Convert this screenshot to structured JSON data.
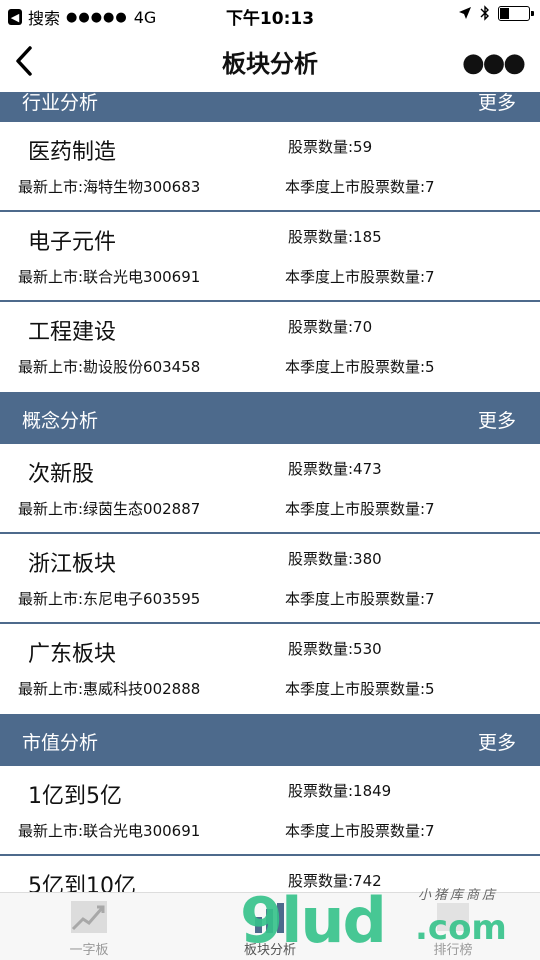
{
  "status_bar": {
    "carrier": "搜索",
    "signal": "●●●●●",
    "network": "4G",
    "time": "下午10:13"
  },
  "nav": {
    "title": "板块分析",
    "more_label": "●●●"
  },
  "sections": [
    {
      "title": "行业分析",
      "more": "更多",
      "items": [
        {
          "name": "医药制造",
          "count": "股票数量:59",
          "latest": "最新上市:海特生物300683",
          "quarter": "本季度上市股票数量:7"
        },
        {
          "name": "电子元件",
          "count": "股票数量:185",
          "latest": "最新上市:联合光电300691",
          "quarter": "本季度上市股票数量:7"
        },
        {
          "name": "工程建设",
          "count": "股票数量:70",
          "latest": "最新上市:勘设股份603458",
          "quarter": "本季度上市股票数量:5"
        }
      ]
    },
    {
      "title": "概念分析",
      "more": "更多",
      "items": [
        {
          "name": "次新股",
          "count": "股票数量:473",
          "latest": "最新上市:绿茵生态002887",
          "quarter": "本季度上市股票数量:7"
        },
        {
          "name": "浙江板块",
          "count": "股票数量:380",
          "latest": "最新上市:东尼电子603595",
          "quarter": "本季度上市股票数量:7"
        },
        {
          "name": "广东板块",
          "count": "股票数量:530",
          "latest": "最新上市:惠威科技002888",
          "quarter": "本季度上市股票数量:5"
        }
      ]
    },
    {
      "title": "市值分析",
      "more": "更多",
      "items": [
        {
          "name": "1亿到5亿",
          "count": "股票数量:1849",
          "latest": "最新上市:联合光电300691",
          "quarter": "本季度上市股票数量:7"
        },
        {
          "name": "5亿到10亿",
          "count": "股票数量:742",
          "latest": "",
          "quarter": ""
        }
      ]
    }
  ],
  "tabs": [
    {
      "label": "一字板"
    },
    {
      "label": "板块分析"
    },
    {
      "label": "排行榜"
    }
  ],
  "watermark": {
    "main": "9lud",
    "com": ".com",
    "sub": "小猪库商店"
  },
  "colors": {
    "section_header": "#4d6a8c",
    "watermark": "#35c28a"
  }
}
